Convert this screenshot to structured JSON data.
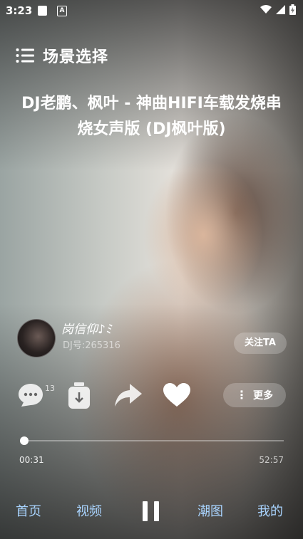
{
  "status_bar": {
    "time": "3:23",
    "notif_glyph": "A",
    "icons": [
      "square-icon",
      "a-badge-icon",
      "wifi-icon",
      "signal-icon",
      "battery-icon"
    ]
  },
  "header": {
    "menu_icon": "list-icon",
    "title": "场景选择"
  },
  "song": {
    "title": "DJ老鹏、枫叶 - 神曲HIFI车载发烧串烧女声版 (DJ枫叶版)"
  },
  "dj": {
    "name": "岗信仰♪ﾐ",
    "id_text": "DJ号:265316",
    "follow_label": "关注TA"
  },
  "actions": {
    "comment_count": "13",
    "more_label": "更多",
    "icons": [
      "comment-icon",
      "download-icon",
      "share-icon",
      "heart-icon",
      "more-dots-icon"
    ]
  },
  "player": {
    "current_time": "00:31",
    "total_time": "52:57",
    "progress": 0.0098
  },
  "nav": {
    "home": "首页",
    "video": "视频",
    "trend": "潮图",
    "mine": "我的"
  },
  "colors": {
    "nav_text": "#a9d4ff",
    "text": "#ffffff"
  }
}
